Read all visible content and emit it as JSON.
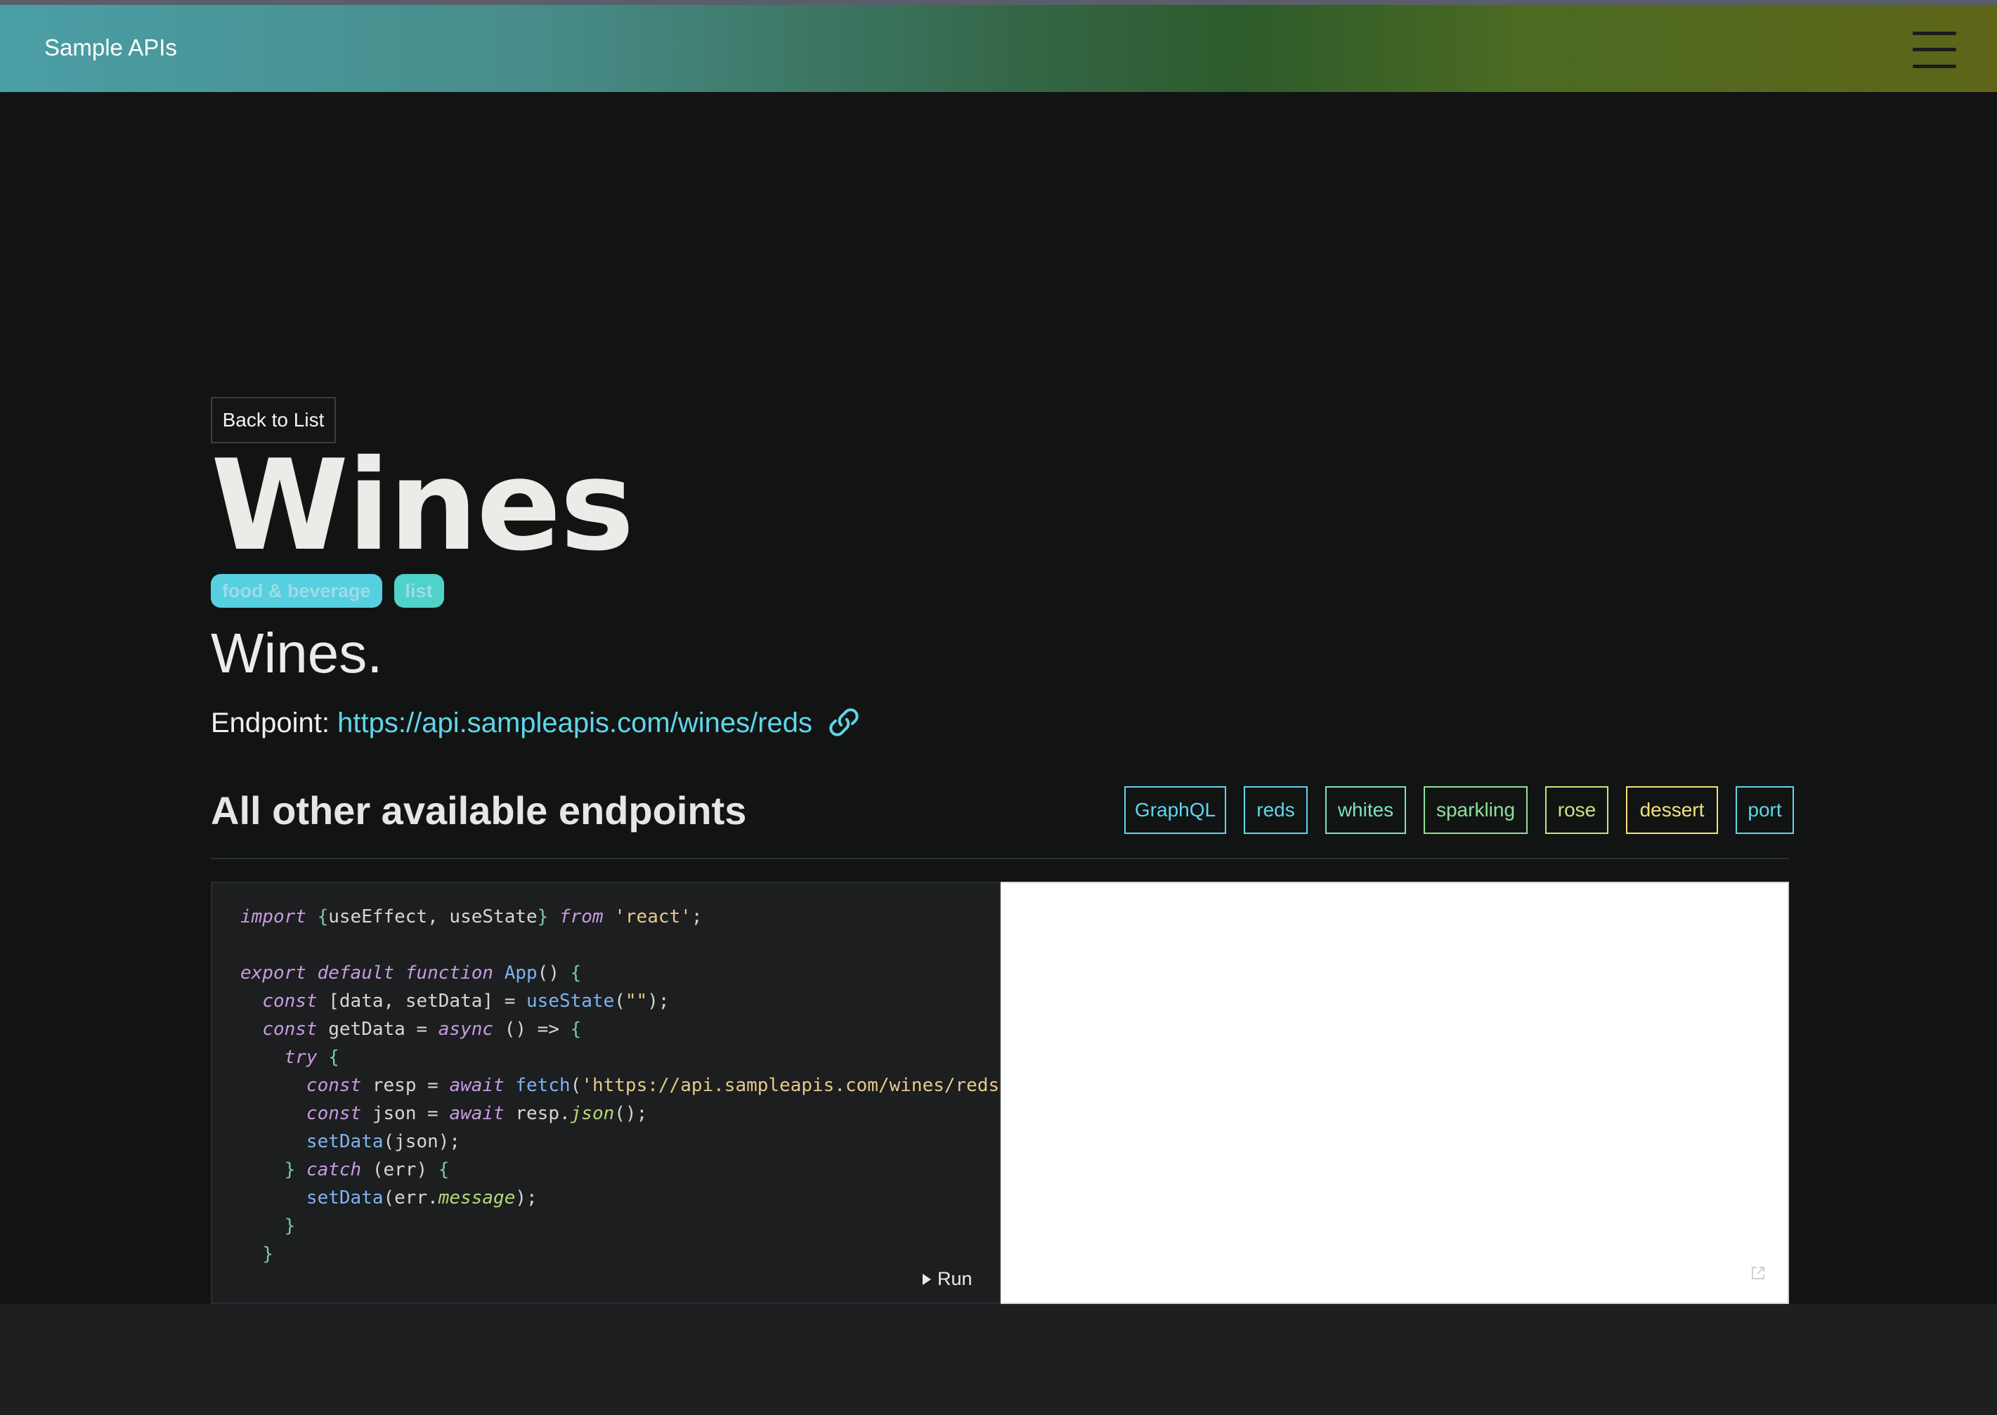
{
  "nav": {
    "brand": "Sample APIs"
  },
  "page": {
    "back_label": "Back to List",
    "title": "Wines",
    "tags": [
      "food & beverage",
      "list"
    ],
    "description": "Wines.",
    "endpoint_label": "Endpoint:",
    "endpoint_url": "https://api.sampleapis.com/wines/reds"
  },
  "section": {
    "title": "All other available endpoints",
    "buttons": [
      {
        "label": "GraphQL",
        "color": "#5fd6ea"
      },
      {
        "label": "reds",
        "color": "#5fd6ea"
      },
      {
        "label": "whites",
        "color": "#7ee0c2"
      },
      {
        "label": "sparkling",
        "color": "#8de19a"
      },
      {
        "label": "rose",
        "color": "#c6e680"
      },
      {
        "label": "dessert",
        "color": "#f2e07a"
      },
      {
        "label": "port",
        "color": "#5fd6ea"
      }
    ]
  },
  "editor": {
    "run_label": "Run",
    "code_lines": [
      "import {useEffect, useState} from 'react';",
      "",
      "export default function App() {",
      "  const [data, setData] = useState(\"\");",
      "  const getData = async () => {",
      "    try {",
      "      const resp = await fetch('https://api.sampleapis.com/wines/reds",
      "      const json = await resp.json();",
      "      setData(json);",
      "    } catch (err) {",
      "      setData(err.message);",
      "    }",
      "  }"
    ]
  },
  "icons": {
    "menu": "hamburger-menu-icon",
    "link": "link-icon",
    "run": "play-icon",
    "open": "external-link-icon"
  }
}
